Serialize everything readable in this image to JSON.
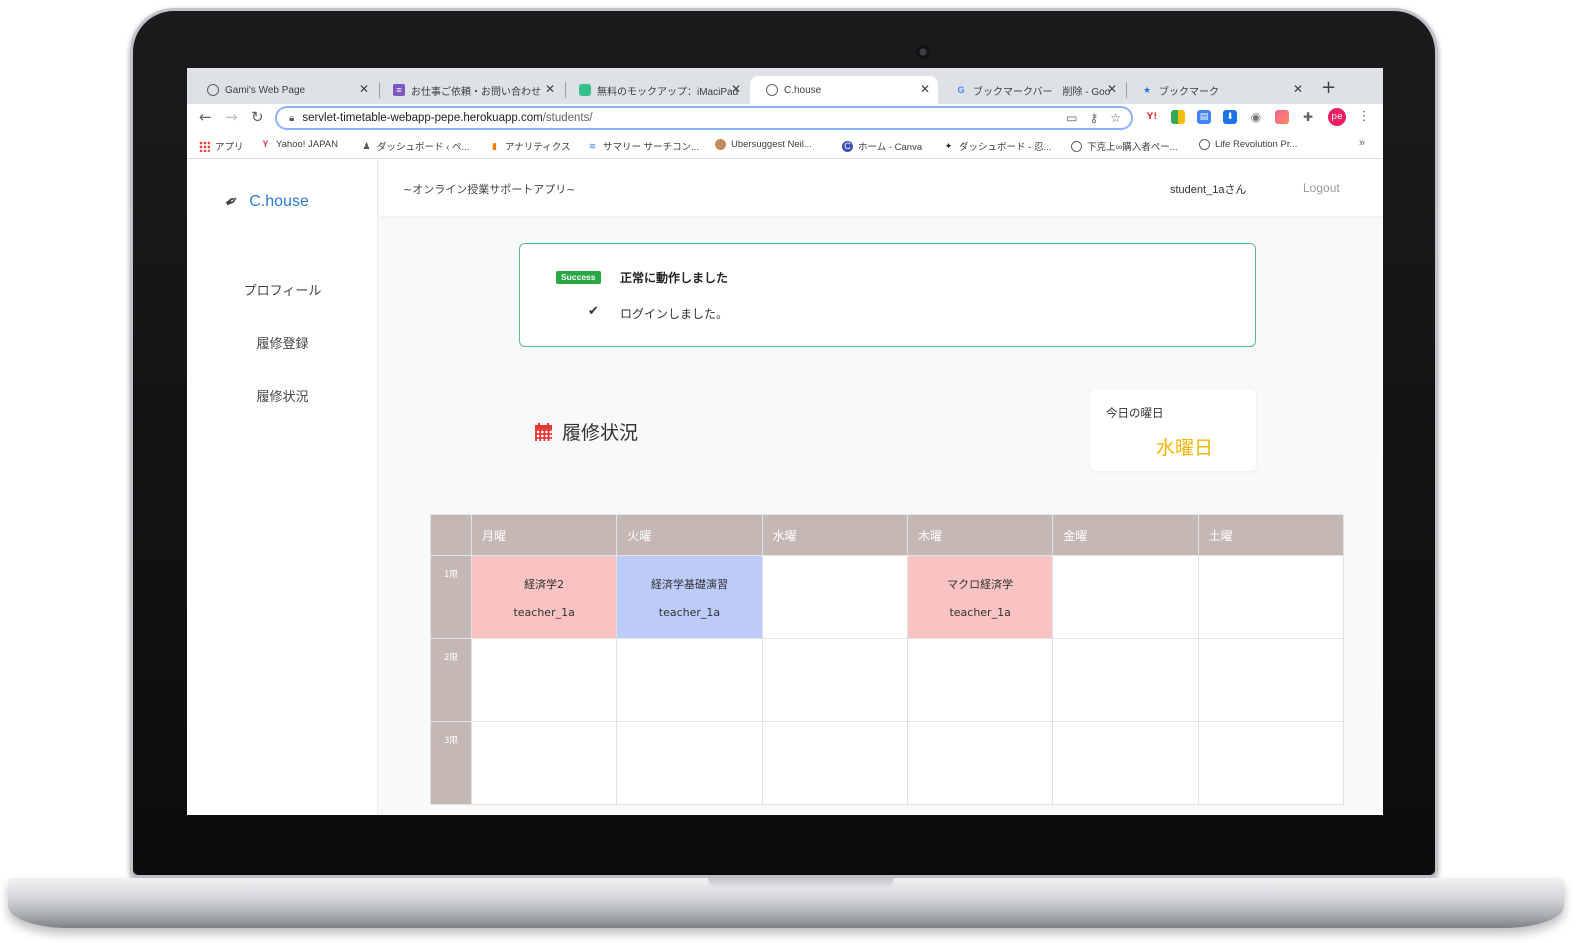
{
  "browser": {
    "tabs": [
      {
        "title": "Gami's Web Page"
      },
      {
        "title": "お仕事ご依頼・お問い合わせ"
      },
      {
        "title": "無料のモックアップ：iMaciPad"
      },
      {
        "title": "C.house"
      },
      {
        "title": "ブックマークバー　削除 - Goo"
      },
      {
        "title": "ブックマーク"
      }
    ],
    "url_host": "servlet-timetable-webapp-pepe.herokuapp.com",
    "url_path": "/students/",
    "profile_initials": "pe",
    "bookmarks": [
      "アプリ",
      "Yahoo! JAPAN",
      "ダッシュボード ‹ ペ...",
      "アナリティクス",
      "サマリー サーチコン...",
      "Ubersuggest Neil...",
      "ホーム - Canva",
      "ダッシュボード - 忍...",
      "下克上∞購入者ペー...",
      "Life Revolution Pr..."
    ]
  },
  "app": {
    "brand": "C.house",
    "subtitle": "~オンライン授業サポートアプリ~",
    "user": "student_1aさん",
    "logout": "Logout",
    "nav": [
      "プロフィール",
      "履修登録",
      "履修状況"
    ],
    "alert": {
      "badge": "Success",
      "title": "正常に動作しました",
      "message": "ログインしました。"
    },
    "page_title": "履修状況",
    "today": {
      "label": "今日の曜日",
      "value": "水曜日"
    },
    "timetable": {
      "days": [
        "月曜",
        "火曜",
        "水曜",
        "木曜",
        "金曜",
        "土曜"
      ],
      "periods": [
        "1限",
        "2限",
        "3限"
      ],
      "cells": {
        "p1_mon": {
          "name": "経済学2",
          "teacher": "teacher_1a"
        },
        "p1_tue": {
          "name": "経済学基礎演習",
          "teacher": "teacher_1a"
        },
        "p1_thu": {
          "name": "マクロ経済学",
          "teacher": "teacher_1a"
        }
      }
    }
  },
  "colors": {
    "brand_blue": "#2a7ad6",
    "success_green": "#28a745",
    "today_yellow": "#f5b400",
    "table_header": "#c5b7b3",
    "cell_pink": "#f8c3c2",
    "cell_blue": "#bccbf9",
    "calendar_red": "#e53935"
  },
  "icons": [
    "pen-icon",
    "calendar-icon",
    "check-icon",
    "lock-icon",
    "star-icon",
    "key-icon",
    "cast-icon",
    "puzzle-icon",
    "menu-dots-icon"
  ]
}
